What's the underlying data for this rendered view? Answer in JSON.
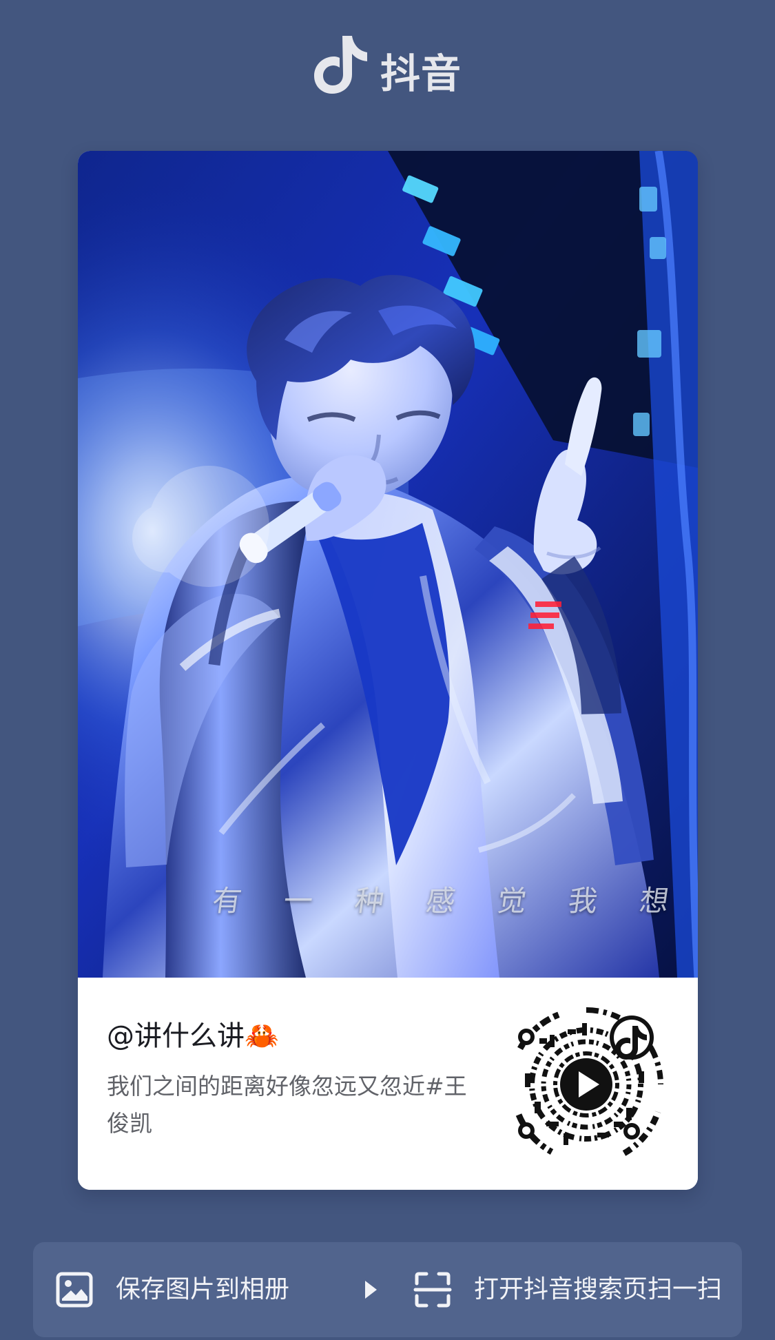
{
  "app": {
    "name": "抖音",
    "logo_icon": "tiktok-note-icon"
  },
  "cover": {
    "overlay_text": "有 一 种 感 觉 我 想",
    "image_description": "concert-performer-photo"
  },
  "post": {
    "username": "@讲什么讲🦀",
    "caption": "我们之间的距离好像忽远又忽近#王俊凯",
    "qr_icon": "douyin-qr-code",
    "play_icon": "play-icon"
  },
  "actions": {
    "save_label": "保存图片到相册",
    "save_icon": "image-icon",
    "scan_label": "打开抖音搜索页扫一扫",
    "scan_icon": "scan-icon"
  },
  "colors": {
    "background": "#43567f",
    "bar": "#51648d",
    "card": "#ffffff",
    "text_light": "#f2f3f7",
    "text_dark": "#1b1c22",
    "text_muted": "#606268"
  }
}
